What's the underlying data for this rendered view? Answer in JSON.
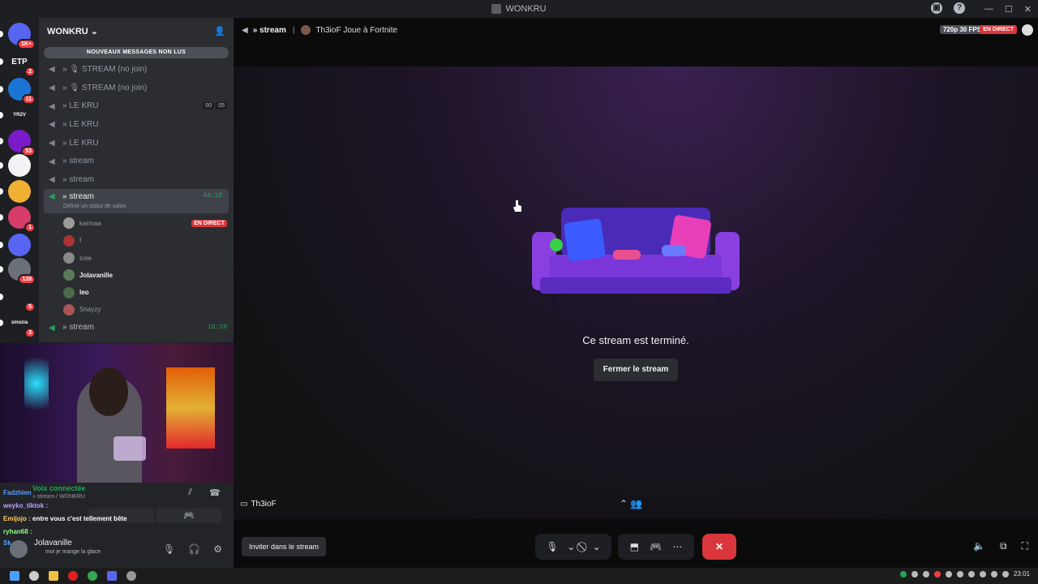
{
  "window": {
    "title": "WONKRU"
  },
  "rail": {
    "items": [
      {
        "label": "",
        "badge": "1K+",
        "color": "#5865f2"
      },
      {
        "label": "ETP",
        "badge": "2",
        "color": "#1e1f22"
      },
      {
        "label": "",
        "badge": "11",
        "color": "#1b74d3"
      },
      {
        "label": "YR2V",
        "badge": "",
        "color": "#1e1f22"
      },
      {
        "label": "",
        "badge": "53",
        "color": "#7a1ac9"
      },
      {
        "label": "",
        "badge": "",
        "color": "#f2f3f5"
      },
      {
        "label": "",
        "badge": "",
        "color": "#f0b132"
      },
      {
        "label": "",
        "badge": "1",
        "color": "#d83c6a"
      },
      {
        "label": "",
        "badge": "",
        "color": "#5865f2"
      },
      {
        "label": "",
        "badge": "139",
        "color": "#6a6f78"
      },
      {
        "label": "",
        "badge": "5",
        "color": "#1e1f22"
      },
      {
        "label": "sinozia",
        "badge": "3",
        "color": "#1e1f22"
      }
    ]
  },
  "guild": {
    "name": "WONKRU",
    "unread_banner": "NOUVEAUX MESSAGES NON LUS",
    "channels": [
      {
        "name": "» 🎙 STREAM (no join)"
      },
      {
        "name": "» 🎙 STREAM (no join)"
      },
      {
        "name": "» LE KRU",
        "counts": [
          "00",
          "05"
        ]
      },
      {
        "name": "» LE KRU"
      },
      {
        "name": "» LE KRU"
      },
      {
        "name": "» stream"
      },
      {
        "name": "» stream"
      }
    ],
    "active_channel": {
      "name": "» stream",
      "time": "44:19",
      "status_hint": "Définir un statut de salon"
    },
    "voice_users": [
      {
        "name": "karmaa",
        "live": "EN DIRECT",
        "color": "#9b9b9b",
        "bright": false
      },
      {
        "name": "f",
        "live": "",
        "color": "#a33",
        "bright": false
      },
      {
        "name": "Icee",
        "live": "",
        "color": "#888",
        "bright": false
      },
      {
        "name": "Jolavanille",
        "live": "",
        "color": "#5a7a5a",
        "bright": true
      },
      {
        "name": "leo",
        "live": "",
        "color": "#4a6a4a",
        "bright": true
      },
      {
        "name": "Snayzy",
        "live": "",
        "color": "#a55",
        "bright": false
      }
    ],
    "last_channel": {
      "name": "» stream",
      "time": "16:20"
    }
  },
  "voice_panel": {
    "status": "Voix connectée",
    "location": "» stream / WONKRU",
    "chat": [
      {
        "user": "Fadzhien",
        "text": ""
      },
      {
        "user": "weyko_tiktok :",
        "text": ""
      },
      {
        "user": "Emijojo :",
        "text": "entre vous c'est tellement bête"
      },
      {
        "user": "ryhan68 :",
        "text": ""
      },
      {
        "user": "Sk",
        "text": ""
      }
    ]
  },
  "user": {
    "name": "Jolavanille",
    "status": "moi je mange la glace"
  },
  "stream": {
    "channel": "» stream",
    "activity": "Th3ioF Joue à Fortnite",
    "quality": "720p 30 FPS",
    "live": "EN DIRECT",
    "ended_text": "Ce stream est terminé.",
    "close_label": "Fermer le stream",
    "streamer": "Th3ioF",
    "invite_label": "Inviter dans le stream"
  },
  "taskbar": {
    "clock": "23:01"
  }
}
